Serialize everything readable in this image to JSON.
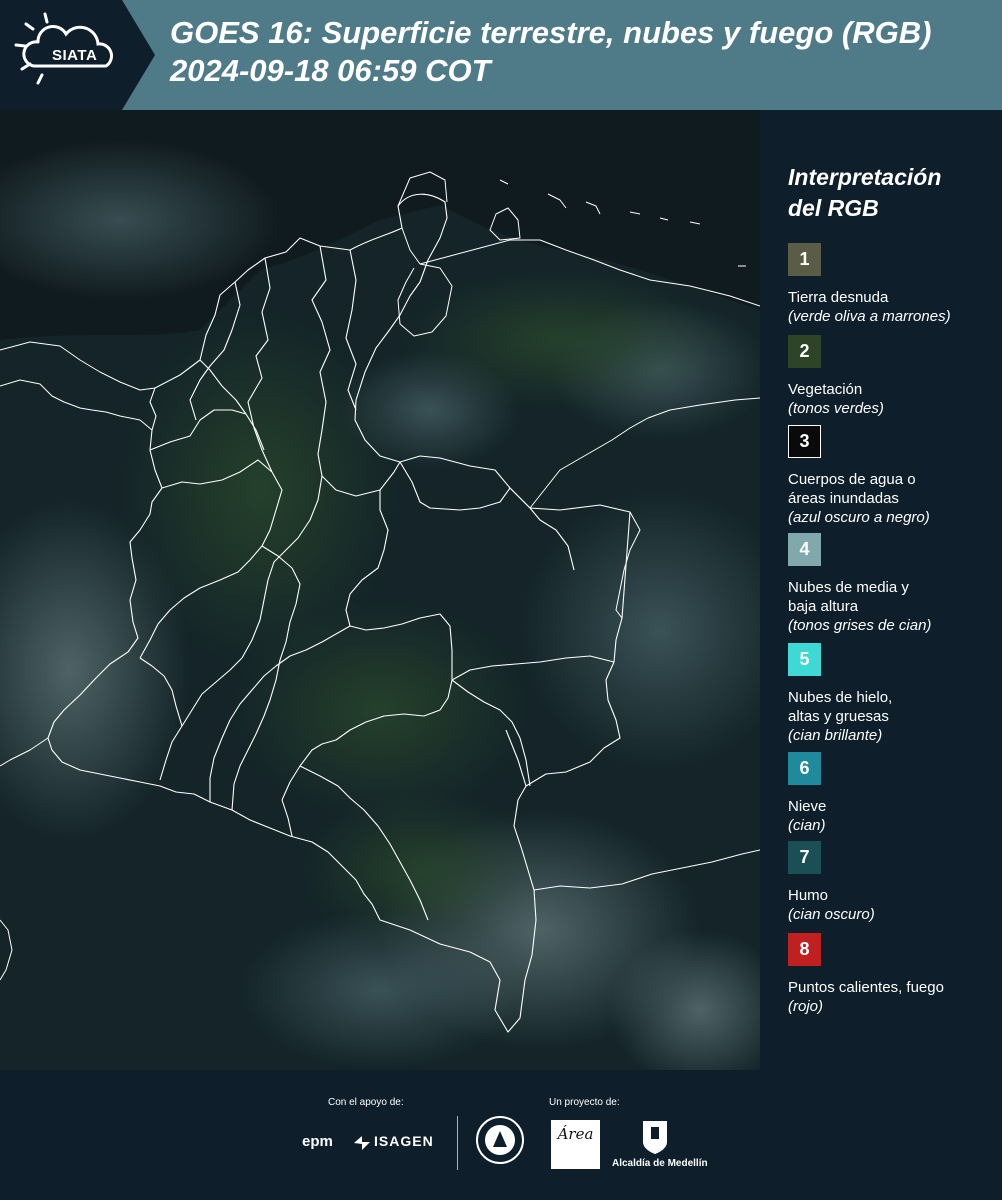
{
  "header": {
    "logo_text": "SIATA",
    "title": "GOES 16: Superficie terrestre, nubes y fuego (RGB)\n 2024-09-18 06:59 COT"
  },
  "legend": {
    "title": "Interpretación\ndel RGB",
    "items": [
      {
        "number": "1",
        "label": "Tierra desnuda",
        "note": "(verde oliva a marrones)",
        "color": "#5a5c45"
      },
      {
        "number": "2",
        "label": "Vegetación",
        "note": "(tonos verdes)",
        "color": "#2d4426"
      },
      {
        "number": "3",
        "label": "Cuerpos de agua o\náreas inundadas",
        "note": "(azul oscuro a negro)",
        "color": "#0a0a0a"
      },
      {
        "number": "4",
        "label": "Nubes de media y\nbaja altura",
        "note": "(tonos grises de cian)",
        "color": "#81a9ab"
      },
      {
        "number": "5",
        "label": "Nubes de hielo,\naltas y gruesas",
        "note": "(cian brillante)",
        "color": "#3ed9d4"
      },
      {
        "number": "6",
        "label": "Nieve",
        "note": "(cian)",
        "color": "#1f8a9c"
      },
      {
        "number": "7",
        "label": "Humo",
        "note": "(cian oscuro)",
        "color": "#1a4f55"
      },
      {
        "number": "8",
        "label": "Puntos calientes, fuego",
        "note": "(rojo)",
        "color": "#c0201f"
      }
    ]
  },
  "footer": {
    "support_label": "Con el apoyo de:",
    "project_label": "Un proyecto de:",
    "sponsors": [
      "epm",
      "ISAGEN"
    ],
    "area_logo_text": "Área",
    "alcaldia": "Alcaldía de Medellín"
  }
}
